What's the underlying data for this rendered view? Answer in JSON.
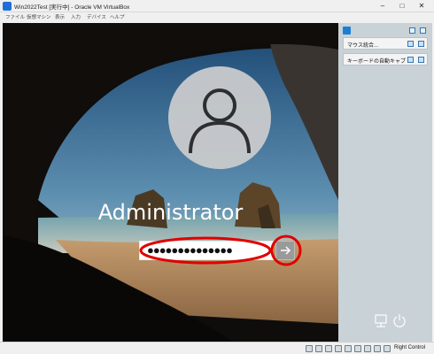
{
  "window": {
    "title": "Win2022Test [実行中] - Oracle VM VirtualBox",
    "minimize": "–",
    "maximize": "□",
    "close": "✕"
  },
  "menu": [
    "ファイル",
    "仮想マシン",
    "表示",
    "入力",
    "デバイス",
    "ヘルプ"
  ],
  "login": {
    "username": "Administrator",
    "password_masked": "●●●●●●●●●●●●●●",
    "submit_icon": "arrow-right-icon",
    "highlight_color": "#e00000"
  },
  "panel": {
    "items": [
      {
        "label": "マウス統合..."
      },
      {
        "label": "キーボードの自動キャプチャー..."
      }
    ]
  },
  "status": {
    "host_key": "Right Control"
  },
  "colors": {
    "accent": "#1a7fd4",
    "annotation": "#e00000"
  }
}
